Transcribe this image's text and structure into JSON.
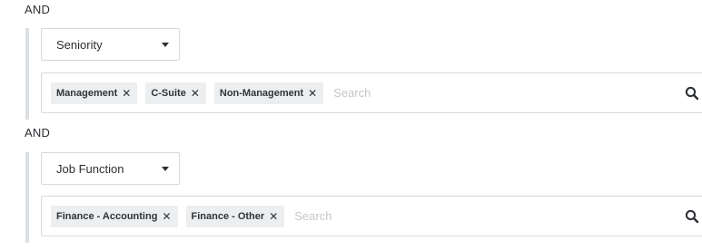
{
  "groups": [
    {
      "connector": "AND",
      "select_label": "Seniority",
      "tags": [
        "Management",
        "C-Suite",
        "Non-Management"
      ],
      "search_placeholder": "Search"
    },
    {
      "connector": "AND",
      "select_label": "Job Function",
      "tags": [
        "Finance - Accounting",
        "Finance - Other"
      ],
      "search_placeholder": "Search"
    }
  ],
  "icons": {
    "remove": "x-icon",
    "search": "search-icon",
    "dropdown": "chevron-down-icon"
  },
  "colors": {
    "tag_bg": "#eceef0",
    "border": "#d6d9dc",
    "group_bar": "#dcdfe2",
    "placeholder": "#c3c7cb"
  }
}
